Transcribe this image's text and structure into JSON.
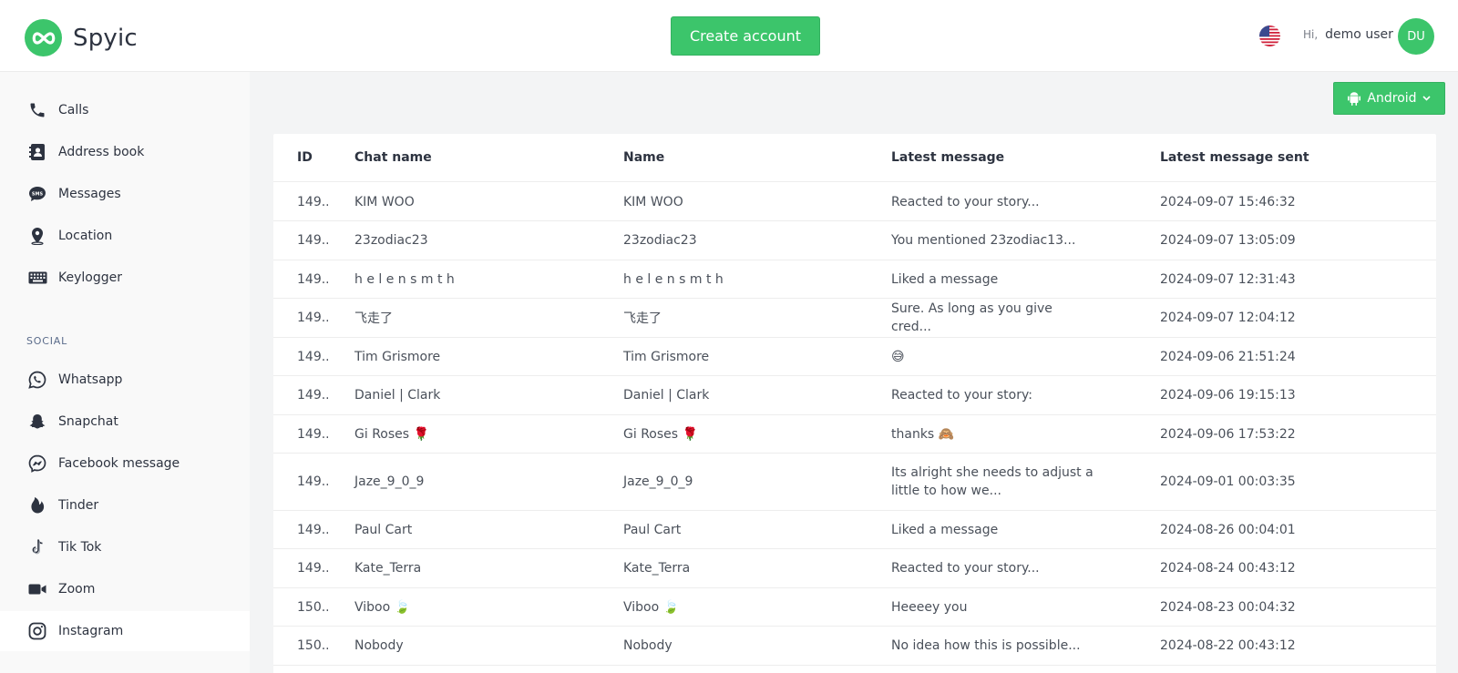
{
  "app": {
    "name": "Spyic"
  },
  "header": {
    "create_account_label": "Create account",
    "greeting_hi": "Hi,",
    "user_name": "demo user",
    "avatar_initials": "DU"
  },
  "device_selector": {
    "label": "Android"
  },
  "sidebar": {
    "items": [
      {
        "label": "Calls",
        "icon": "phone-icon"
      },
      {
        "label": "Address book",
        "icon": "address-book-icon"
      },
      {
        "label": "Messages",
        "icon": "sms-icon"
      },
      {
        "label": "Location",
        "icon": "location-pin-icon"
      },
      {
        "label": "Keylogger",
        "icon": "keyboard-icon"
      }
    ],
    "social_section_label": "SOCIAL",
    "social_items": [
      {
        "label": "Whatsapp",
        "icon": "whatsapp-icon"
      },
      {
        "label": "Snapchat",
        "icon": "snapchat-icon"
      },
      {
        "label": "Facebook message",
        "icon": "messenger-icon"
      },
      {
        "label": "Tinder",
        "icon": "tinder-flame-icon"
      },
      {
        "label": "Tik Tok",
        "icon": "tiktok-icon"
      },
      {
        "label": "Zoom",
        "icon": "zoom-camera-icon"
      },
      {
        "label": "Instagram",
        "icon": "instagram-icon",
        "active": true
      }
    ]
  },
  "table": {
    "headers": {
      "id": "ID",
      "chat_name": "Chat name",
      "name": "Name",
      "latest_message": "Latest message",
      "latest_sent": "Latest message sent"
    },
    "rows": [
      {
        "id": "149...",
        "chat_name": "KIM WOO",
        "name": "KIM WOO",
        "latest_message": "Reacted to your story...",
        "sent": "2024-09-07 15:46:32"
      },
      {
        "id": "149...",
        "chat_name": "23zodiac23",
        "name": "23zodiac23",
        "latest_message": "You mentioned 23zodiac13...",
        "sent": "2024-09-07 13:05:09"
      },
      {
        "id": "149...",
        "chat_name": "h e l e n s m t h",
        "name": "h e l e n s m t h",
        "latest_message": "Liked a message",
        "sent": "2024-09-07 12:31:43"
      },
      {
        "id": "149...",
        "chat_name": "飞走了",
        "name": "飞走了",
        "latest_message": "Sure. As long as you give cred...",
        "sent": "2024-09-07 12:04:12"
      },
      {
        "id": "149...",
        "chat_name": "Tim Grismore",
        "name": "Tim Grismore",
        "latest_message": "😅",
        "sent": "2024-09-06 21:51:24"
      },
      {
        "id": "149...",
        "chat_name": "Daniel | Clark",
        "name": "Daniel | Clark",
        "latest_message": "Reacted to your story:",
        "sent": "2024-09-06 19:15:13"
      },
      {
        "id": "149...",
        "chat_name": "Gi Roses 🌹",
        "name": "Gi Roses 🌹",
        "latest_message": "thanks 🙈",
        "sent": "2024-09-06 17:53:22"
      },
      {
        "id": "149...",
        "chat_name": "Jaze_9_0_9",
        "name": "Jaze_9_0_9",
        "latest_message": "Its alright she needs to adjust a little to how we...",
        "sent": "2024-09-01 00:03:35"
      },
      {
        "id": "149...",
        "chat_name": "Paul Cart",
        "name": "Paul Cart",
        "latest_message": "Liked a message",
        "sent": "2024-08-26 00:04:01"
      },
      {
        "id": "149...",
        "chat_name": "Kate_Terra",
        "name": "Kate_Terra",
        "latest_message": "Reacted to your story...",
        "sent": "2024-08-24 00:43:12"
      },
      {
        "id": "150...",
        "chat_name": "Viboo 🍃",
        "name": "Viboo 🍃",
        "latest_message": "Heeeey you",
        "sent": "2024-08-23 00:04:32"
      },
      {
        "id": "150...",
        "chat_name": "Nobody",
        "name": "Nobody",
        "latest_message": "No idea how this is possible...",
        "sent": "2024-08-22 00:43:12"
      }
    ]
  }
}
